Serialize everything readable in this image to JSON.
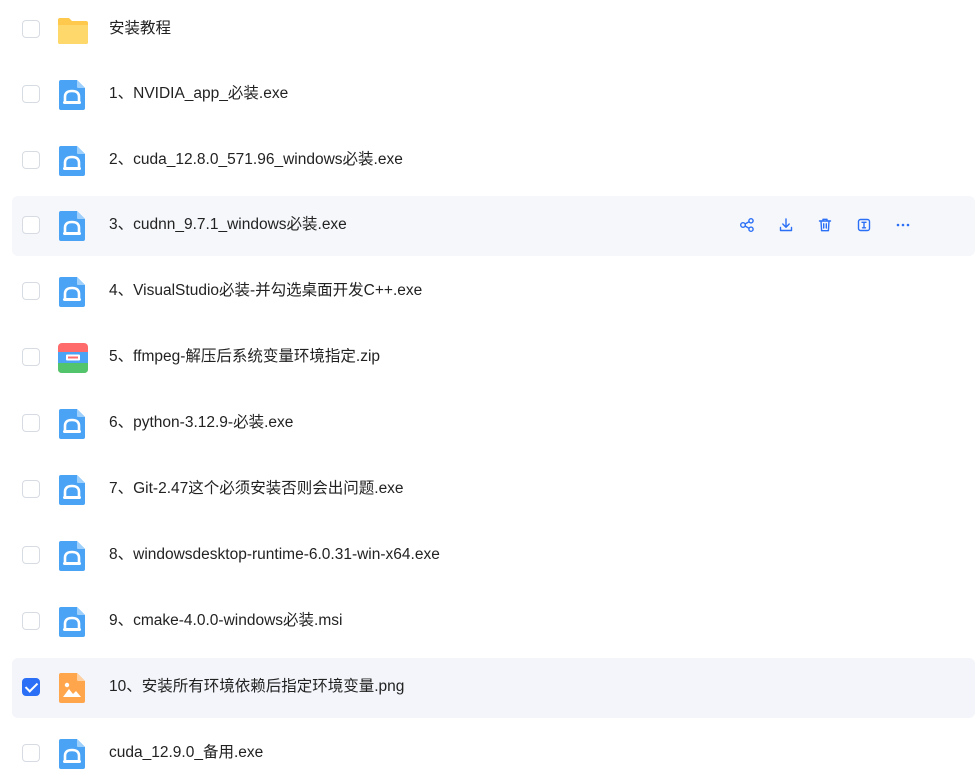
{
  "files": [
    {
      "name": "安装教程",
      "type": "folder",
      "selected": false
    },
    {
      "name": "1、NVIDIA_app_必装.exe",
      "type": "exe",
      "selected": false
    },
    {
      "name": "2、cuda_12.8.0_571.96_windows必装.exe",
      "type": "exe",
      "selected": false
    },
    {
      "name": "3、cudnn_9.7.1_windows必装.exe",
      "type": "exe",
      "selected": false
    },
    {
      "name": "4、VisualStudio必装-并勾选桌面开发C++.exe",
      "type": "exe",
      "selected": false
    },
    {
      "name": "5、ffmpeg-解压后系统变量环境指定.zip",
      "type": "zip",
      "selected": false
    },
    {
      "name": "6、python-3.12.9-必装.exe",
      "type": "exe",
      "selected": false
    },
    {
      "name": "7、Git-2.47这个必须安装否则会出问题.exe",
      "type": "exe",
      "selected": false
    },
    {
      "name": "8、windowsdesktop-runtime-6.0.31-win-x64.exe",
      "type": "exe",
      "selected": false
    },
    {
      "name": "9、cmake-4.0.0-windows必装.msi",
      "type": "exe",
      "selected": false
    },
    {
      "name": "10、安装所有环境依赖后指定环境变量.png",
      "type": "image",
      "selected": true
    },
    {
      "name": "cuda_12.9.0_备用.exe",
      "type": "exe",
      "selected": false
    }
  ],
  "hovered_row_actions": [
    "share-icon",
    "download-icon",
    "delete-icon",
    "rename-icon",
    "more-icon"
  ],
  "colors": {
    "accent": "#2b6ff6",
    "folder": "#ffc94d",
    "exe": "#4aa3f5",
    "image": "#ffa64d",
    "hover_bg": "#f5f7fb"
  }
}
